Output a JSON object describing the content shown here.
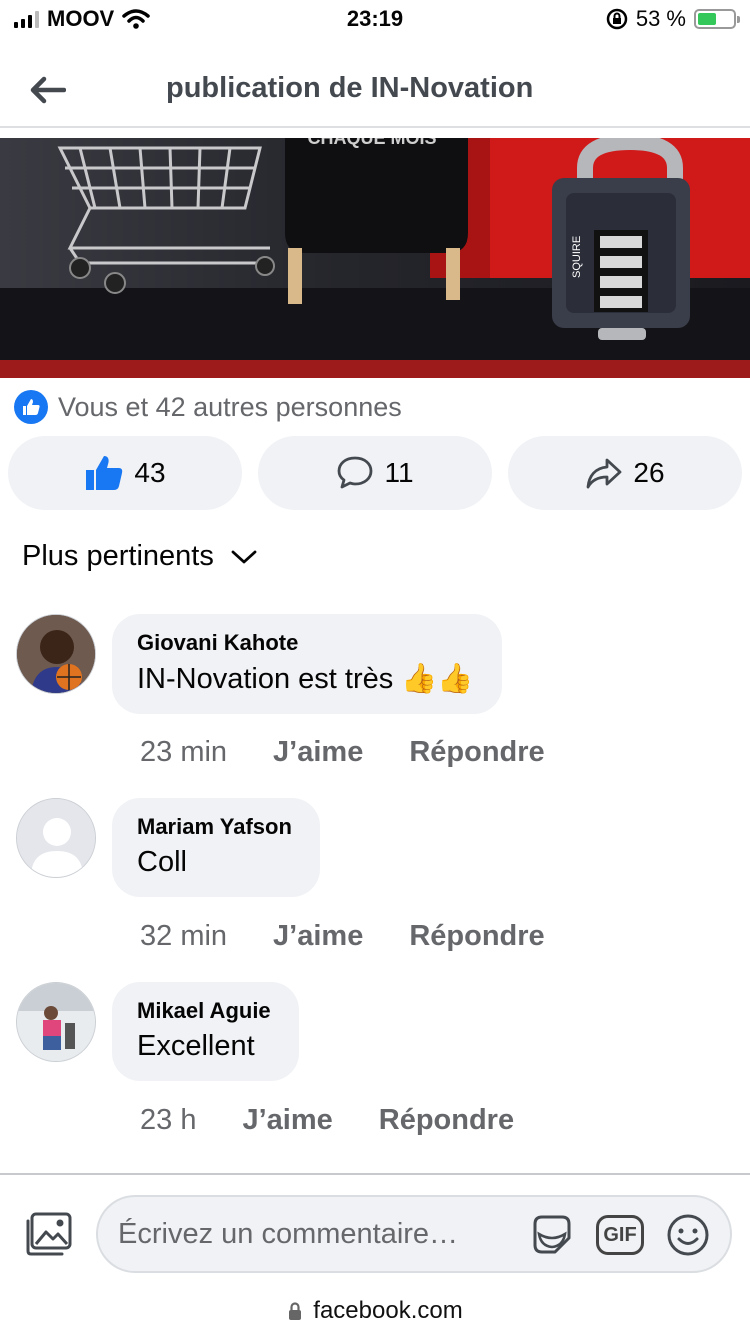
{
  "status": {
    "carrier": "MOOV",
    "time": "23:19",
    "battery": "53 %",
    "battery_level": 0.53
  },
  "header": {
    "title": "publication de IN-Novation"
  },
  "post": {
    "image_text": "CHAQUE MOIS",
    "lock_brand": "SQUIRE",
    "reactions_summary": "Vous et 42 autres personnes",
    "likes": "43",
    "comments": "11",
    "shares": "26"
  },
  "sort": {
    "label": "Plus pertinents"
  },
  "comments": [
    {
      "name": "Giovani Kahote",
      "text": "IN-Novation est très 👍👍",
      "time": "23 min",
      "like_label": "J’aime",
      "reply_label": "Répondre"
    },
    {
      "name": "Mariam Yafson",
      "text": "Coll",
      "time": "32 min",
      "like_label": "J’aime",
      "reply_label": "Répondre"
    },
    {
      "name": "Mikael Aguie",
      "text": "Excellent",
      "time": "23 h",
      "like_label": "J’aime",
      "reply_label": "Répondre"
    }
  ],
  "composer": {
    "placeholder": "Écrivez un commentaire…",
    "gif_label": "GIF"
  },
  "browser": {
    "url": "facebook.com"
  },
  "colors": {
    "accent": "#1877f2",
    "bubble": "#f0f2f5",
    "secondary_text": "#65676b",
    "battery": "#34c759"
  }
}
